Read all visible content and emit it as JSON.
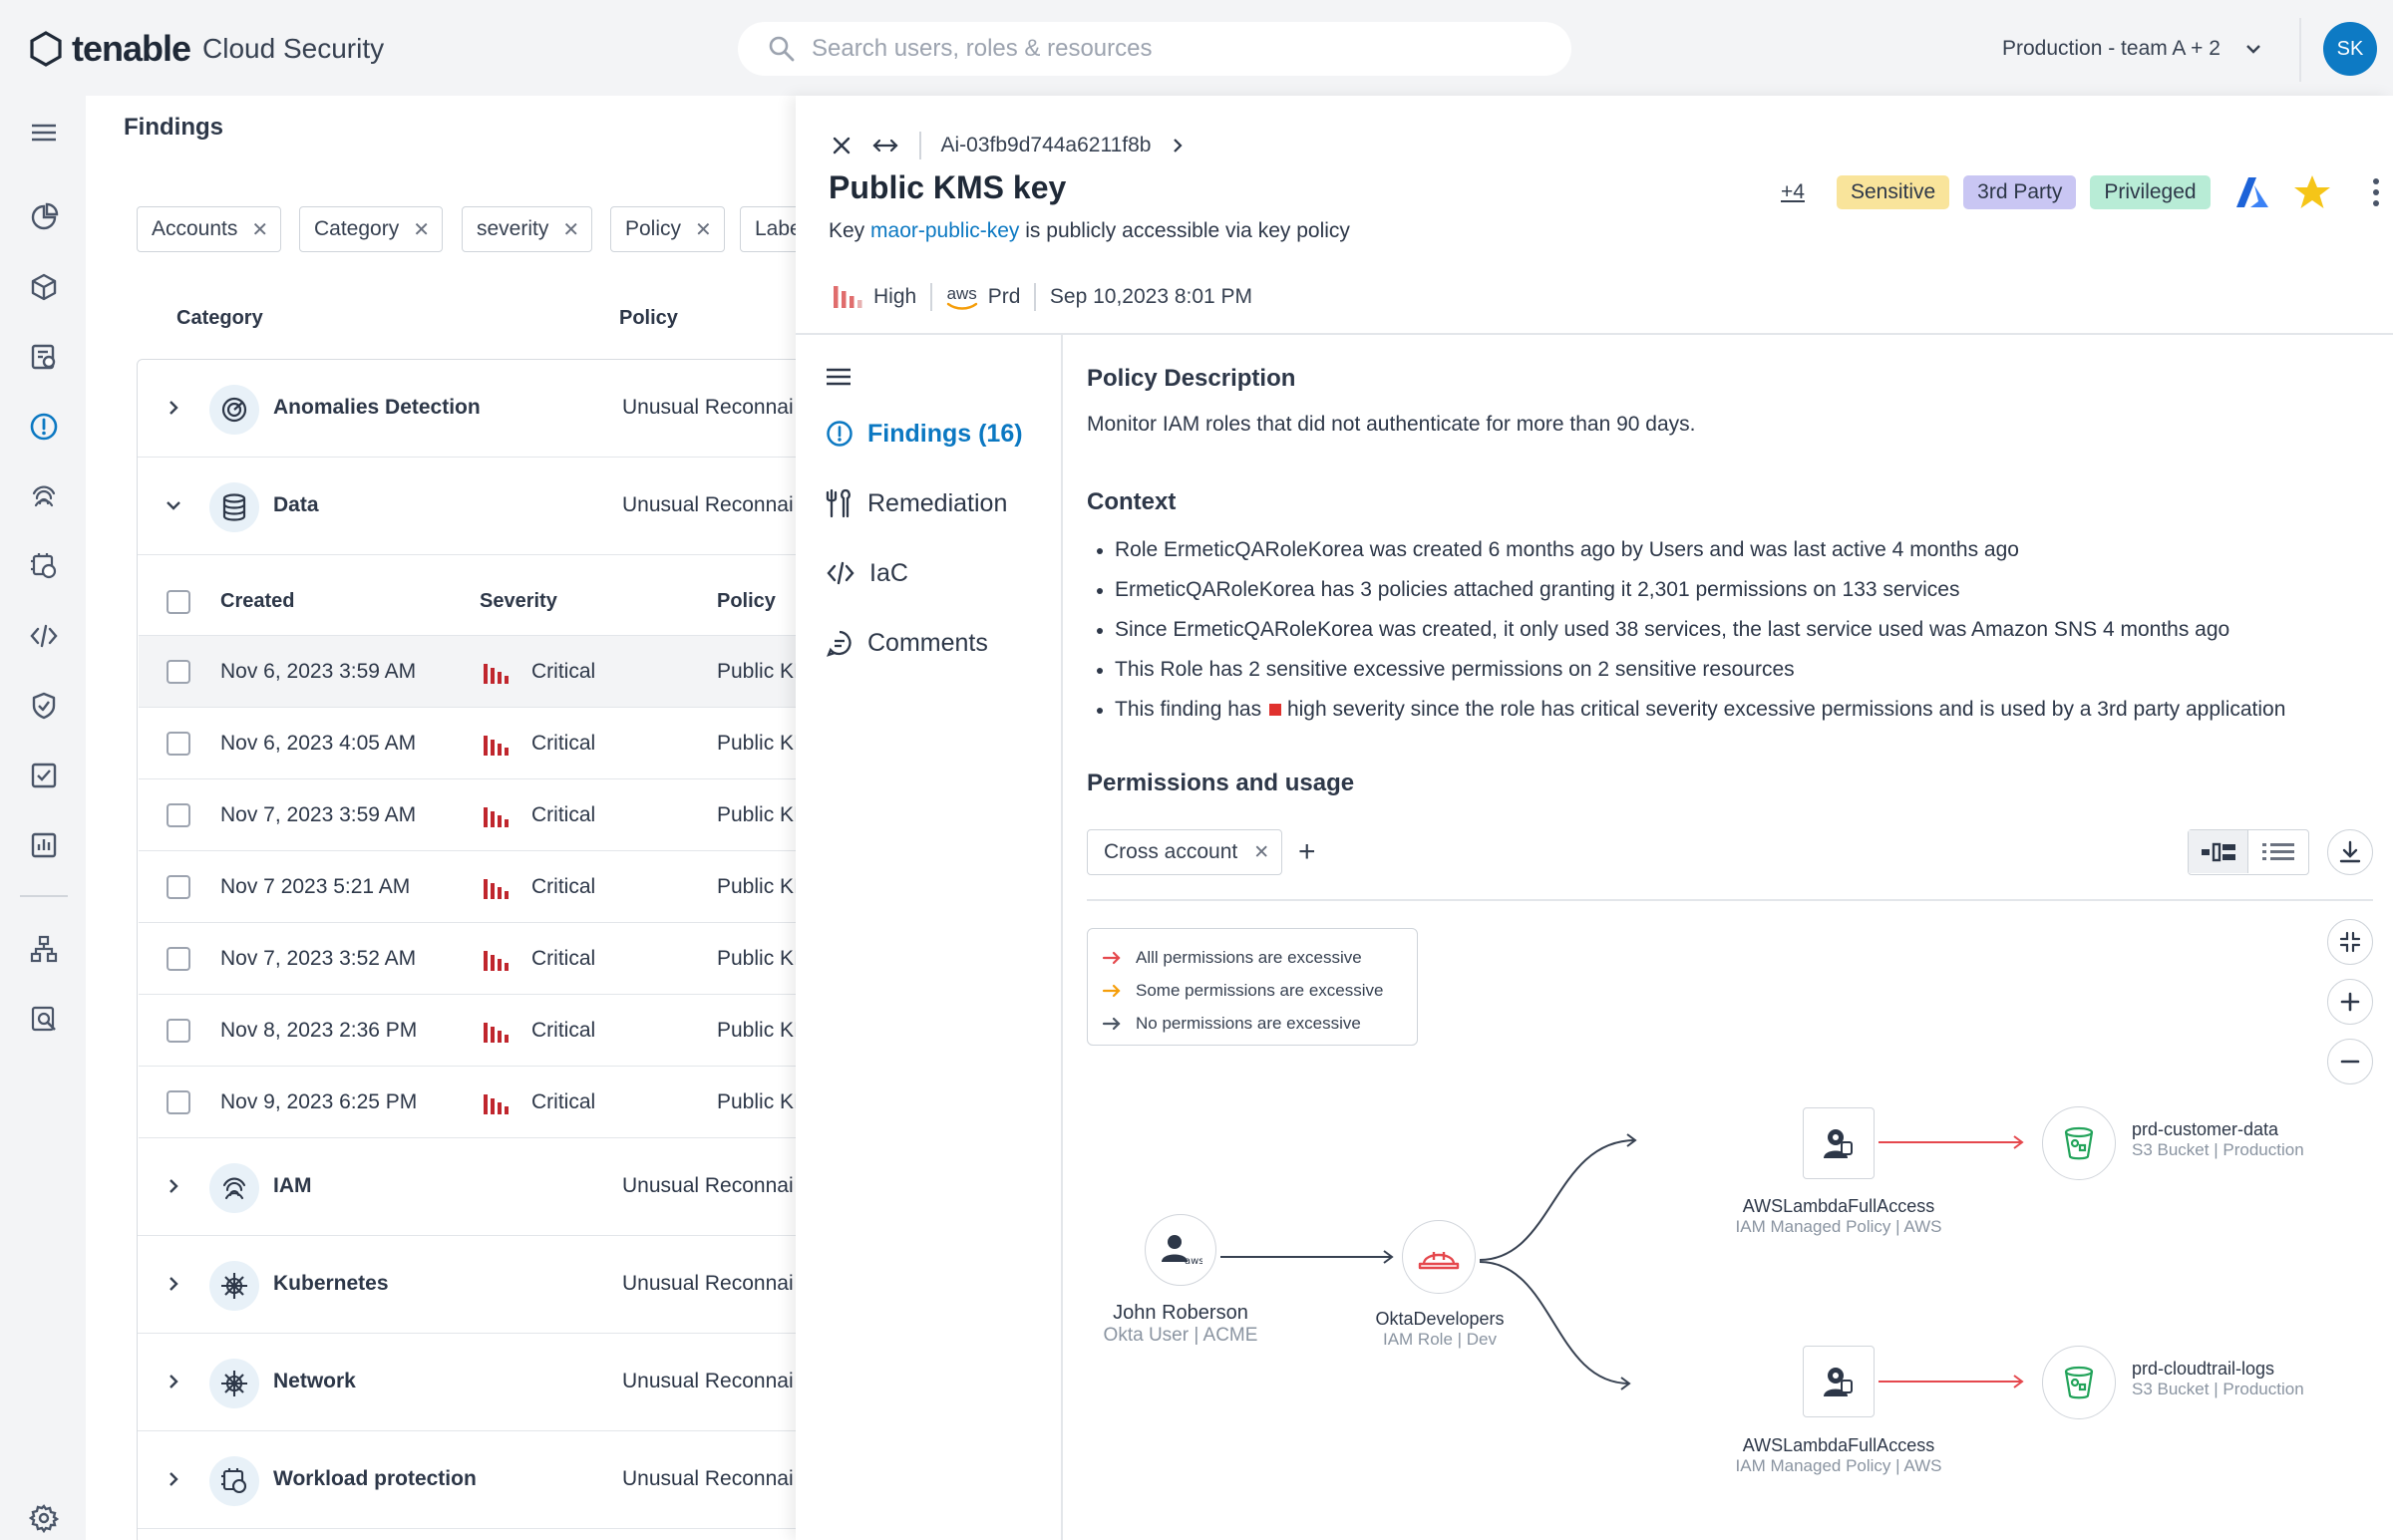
{
  "app": {
    "brand": "tenable",
    "product": "Cloud Security"
  },
  "search": {
    "placeholder": "Search users, roles & resources"
  },
  "environment": {
    "label": "Production - team A + 2"
  },
  "user": {
    "initials": "SK"
  },
  "rail": {
    "icons": [
      "menu-icon",
      "dashboard-icon",
      "inventory-cube-icon",
      "reports-icon",
      "findings-alert-icon",
      "identity-fingerprint-icon",
      "workload-icon",
      "code-icon",
      "shield-icon",
      "tasks-check-icon",
      "analytics-icon",
      "network-tree-icon",
      "search-report-icon",
      "settings-gear-icon"
    ],
    "active": "findings-alert-icon"
  },
  "findings": {
    "title": "Findings",
    "filters": [
      "Accounts",
      "Category",
      "severity",
      "Policy",
      "Labe"
    ],
    "columns": {
      "category": "Category",
      "policy": "Policy"
    },
    "categories": [
      {
        "name": "Anomalies Detection",
        "policy": "Unusual Reconnai",
        "expanded": false
      },
      {
        "name": "Data",
        "policy": "Unusual Reconnai",
        "expanded": true
      },
      {
        "name": "IAM",
        "policy": "Unusual Reconnai",
        "expanded": false
      },
      {
        "name": "Kubernetes",
        "policy": "Unusual Reconnai",
        "expanded": false
      },
      {
        "name": "Network",
        "policy": "Unusual Reconnai",
        "expanded": false
      },
      {
        "name": "Workload protection",
        "policy": "Unusual Reconnai",
        "expanded": false
      }
    ],
    "sub_columns": {
      "created": "Created",
      "severity": "Severity",
      "policy": "Policy"
    },
    "rows": [
      {
        "created": "Nov 6, 2023 3:59 AM",
        "severity": "Critical",
        "policy": "Public KI",
        "selected": true
      },
      {
        "created": "Nov 6, 2023 4:05 AM",
        "severity": "Critical",
        "policy": "Public KI",
        "selected": false
      },
      {
        "created": "Nov 7, 2023 3:59 AM",
        "severity": "Critical",
        "policy": "Public KI",
        "selected": false
      },
      {
        "created": "Nov 7 2023 5:21 AM",
        "severity": "Critical",
        "policy": "Public KI",
        "selected": false
      },
      {
        "created": "Nov 7, 2023 3:52 AM",
        "severity": "Critical",
        "policy": "Public KI",
        "selected": false
      },
      {
        "created": "Nov 8, 2023 2:36 PM",
        "severity": "Critical",
        "policy": "Public KI",
        "selected": false
      },
      {
        "created": "Nov 9, 2023 6:25 PM",
        "severity": "Critical",
        "policy": "Public KI",
        "selected": false
      }
    ]
  },
  "drawer": {
    "resource_id": "Ai-03fb9d744a6211f8b",
    "title": "Public KMS key",
    "subtitle_prefix": "Key",
    "subtitle_link": "maor-public-key",
    "subtitle_suffix": "is publicly accessible via key policy",
    "more_tags": "+4",
    "tags": [
      {
        "label": "Sensitive",
        "color": "#f9e49b"
      },
      {
        "label": "3rd Party",
        "color": "#c9c6f3"
      },
      {
        "label": "Privileged",
        "color": "#b8ecd6"
      }
    ],
    "meta": {
      "severity": "High",
      "provider": "aws",
      "account": "Prd",
      "timestamp": "Sep 10,2023 8:01 PM"
    },
    "nav": [
      {
        "label": "Findings (16)",
        "icon": "alert-circle-icon",
        "active": true
      },
      {
        "label": "Remediation",
        "icon": "tools-icon",
        "active": false
      },
      {
        "label": "IaC",
        "icon": "code-icon",
        "active": false
      },
      {
        "label": "Comments",
        "icon": "comment-icon",
        "active": false
      }
    ],
    "policy_description": {
      "title": "Policy Description",
      "text": "Monitor IAM roles that did not authenticate for more than 90 days."
    },
    "context": {
      "title": "Context",
      "items": [
        "Role ErmeticQARoleKorea was created 6 months ago by Users and was last active 4 months ago",
        "ErmeticQARoleKorea has 3 policies attached granting it 2,301 permissions on 133 services",
        "Since ErmeticQARoleKorea was created, it only used 38 services, the last service used was Amazon SNS 4 months ago",
        "This Role has 2 sensitive excessive permissions on 2 sensitive resources"
      ],
      "last_prefix": "This finding has",
      "last_suffix": "high severity since the role has critical severity excessive permissions and is used by a 3rd party application"
    },
    "permissions": {
      "title": "Permissions and usage",
      "filter_chip": "Cross account",
      "legend": [
        {
          "label": "Alll permissions are excessive",
          "color": "#e5484d"
        },
        {
          "label": "Some permissions are excessive",
          "color": "#f59e0b"
        },
        {
          "label": "No permissions are excessive",
          "color": "#4b5563"
        }
      ],
      "graph": {
        "user": {
          "name": "John Roberson",
          "sub1": "Okta User",
          "sub2": "ACME"
        },
        "role": {
          "name": "OktaDevelopers",
          "sub1": "IAM Role",
          "sub2": "Dev"
        },
        "policies": [
          {
            "name": "AWSLambdaFullAccess",
            "sub1": "IAM Managed Policy",
            "sub2": "AWS"
          },
          {
            "name": "AWSLambdaFullAccess",
            "sub1": "IAM Managed Policy",
            "sub2": "AWS"
          }
        ],
        "resources": [
          {
            "name": "prd-customer-data",
            "sub1": "S3 Bucket",
            "sub2": "Production"
          },
          {
            "name": "prd-cloudtrail-logs",
            "sub1": "S3 Bucket",
            "sub2": "Production"
          }
        ]
      }
    }
  }
}
